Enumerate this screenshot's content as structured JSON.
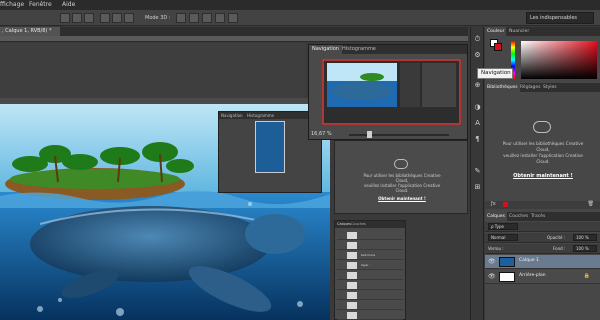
{
  "menubar": {
    "items": [
      "ffichage",
      "Fenêtre",
      "Aide"
    ]
  },
  "options": {
    "mode_label": "Mode 3D :",
    "workspace": "Les indispensables"
  },
  "document": {
    "tab_title": ", Calque 1, RVB/8) *"
  },
  "small_window": {
    "tabs": [
      "Navigation",
      "Histogramme"
    ]
  },
  "navigator": {
    "tabs": [
      "Navigation",
      "Histogramme"
    ],
    "zoom": "16,67 %"
  },
  "mid_panel": {
    "message": [
      "Pour utiliser les bibliothèques Creative",
      "Cloud,",
      "veuillez installer l'application Creative",
      "Cloud."
    ],
    "link": "Obtenir maintenant !"
  },
  "mid_layers": {
    "tabs": [
      "Calques",
      "Couches"
    ],
    "rows": [
      "",
      "",
      "",
      "",
      "bell more",
      "layer",
      "",
      "",
      "",
      "",
      "",
      ""
    ]
  },
  "tooltip": "Navigation",
  "color_panel": {
    "tabs": [
      "Couleur",
      "Nuancier"
    ],
    "colors": {
      "fg": "#ffffff",
      "bg": "#d60f1f"
    }
  },
  "libraries": {
    "tabs": [
      "Bibliothèques",
      "Réglages",
      "Styles"
    ],
    "message": [
      "Pour utiliser les bibliothèques Creative",
      "Cloud,",
      "veuillez installer l'application Creative",
      "Cloud."
    ],
    "link": "Obtenir maintenant !"
  },
  "layers": {
    "tabs": [
      "Calques",
      "Couches",
      "Tracés"
    ],
    "filter": "ρ Type",
    "blend_mode": "Normal",
    "opacity_label": "Opacité :",
    "opacity": "100 %",
    "lock_label": "Verrou :",
    "fill_label": "Fond :",
    "fill": "100 %",
    "items": [
      {
        "name": "Calque 1",
        "selected": true
      },
      {
        "name": "Arrière-plan",
        "selected": false
      }
    ]
  }
}
